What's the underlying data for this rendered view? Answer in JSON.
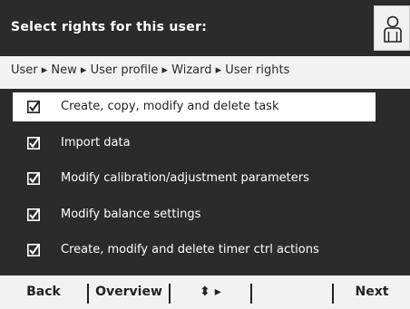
{
  "header": {
    "title": "Select rights for this user:",
    "icon": "user-icon"
  },
  "breadcrumb": "User ▸ New ▸ User profile ▸ Wizard ▸ User rights",
  "items": [
    {
      "label": "Create, copy, modify and delete task",
      "checked": true,
      "selected": true
    },
    {
      "label": "Import data",
      "checked": true,
      "selected": false
    },
    {
      "label": "Modify calibration/adjustment parameters",
      "checked": true,
      "selected": false
    },
    {
      "label": "Modify balance settings",
      "checked": true,
      "selected": false
    },
    {
      "label": "Create, modify and delete timer ctrl actions",
      "checked": true,
      "selected": false
    }
  ],
  "softkeys": {
    "back": "Back",
    "overview": "Overview",
    "navigate": "⬍ ▸",
    "empty": "",
    "next": "Next"
  },
  "colors": {
    "header_bg": "#2b2b2b",
    "body_bg": "#f2f2f2",
    "selected_bg": "#ffffff"
  }
}
